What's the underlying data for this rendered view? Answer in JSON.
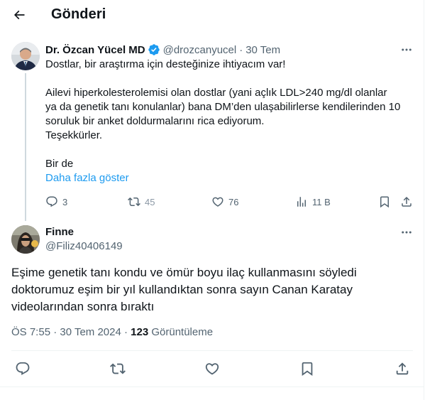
{
  "header": {
    "title": "Gönderi",
    "back_icon": "arrow-left-icon"
  },
  "parent_tweet": {
    "author_name": "Dr. Özcan Yücel MD",
    "verified_color": "#1d9bf0",
    "handle": "@drozcanyucel",
    "separator": "·",
    "time": "30 Tem",
    "lines": [
      "Dostlar, bir araştırma için desteğinize ihtiyacım var!",
      "Ailevi hiperkolesterolemisi olan dostlar (yani açlık LDL>240 mg/dl olanlar",
      "ya da genetik tanı konulanlar) bana DM’den ulaşabilirlerse kendilerinden 10",
      "soruluk bir anket doldurmalarını rica ediyorum.",
      "Teşekkürler.",
      "Bir de"
    ],
    "show_more": "Daha fazla göster",
    "actions": {
      "reply_count": "3",
      "retweet_count": "45",
      "like_count": "76",
      "views_count": "11 B"
    }
  },
  "reply_tweet": {
    "author_name": "Finne",
    "handle": "@Filiz40406149",
    "lines": [
      "Eşime genetik tanı kondu ve ömür boyu ilaç kullanmasını söyledi",
      "doktorumuz eşim bir yıl kullandıktan sonra sayın Canan Karatay",
      "videolarından sonra bıraktı"
    ],
    "time": "ÖS 7:55 · 30 Tem 2024 ·",
    "views_count": "123",
    "views_label": "Görüntüleme"
  },
  "colors": {
    "text_primary": "#0f1419",
    "text_secondary": "#536471",
    "accent": "#1d9bf0",
    "divider": "#eff3f4",
    "thread_line": "#cfd9de"
  }
}
